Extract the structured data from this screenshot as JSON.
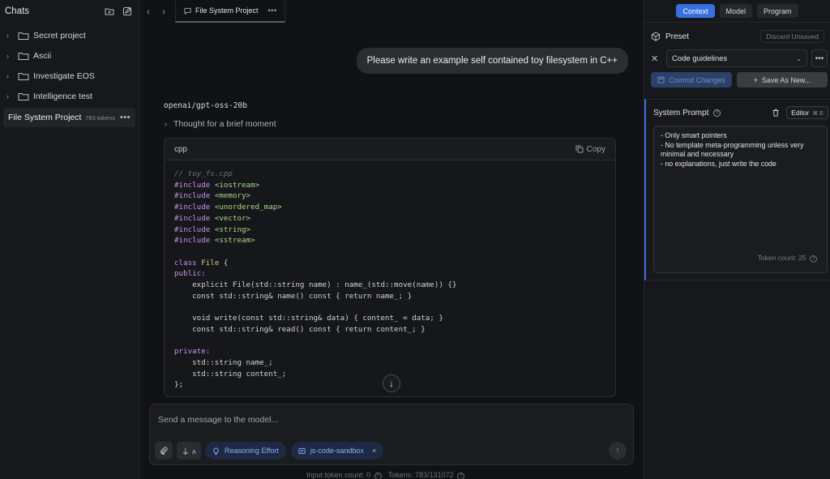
{
  "sidebar": {
    "title": "Chats",
    "items": [
      {
        "label": "Secret project"
      },
      {
        "label": "Ascii"
      },
      {
        "label": "Investigate EOS"
      },
      {
        "label": "Intelligence test"
      }
    ],
    "active": {
      "label": "File System Project",
      "tokens": "783 tokens"
    }
  },
  "topbar": {
    "tab_label": "File System Project"
  },
  "chat": {
    "user_message": "Please write an example self contained toy filesystem in C++",
    "model_name": "openai/gpt-oss-20b",
    "thought": "Thought for a brief moment",
    "code_lang": "cpp",
    "copy_label": "Copy",
    "code": {
      "comment": "// toy_fs.cpp",
      "includes": [
        "<iostream>",
        "<memory>",
        "<unordered_map>",
        "<vector>",
        "<string>",
        "<sstream>"
      ],
      "include_kw": "#include",
      "class_kw": "class",
      "class_name": "File",
      "public_kw": "public:",
      "private_kw": "private:",
      "line_ctor": "explicit File(std::string name) : name_(std::move(name)) {}",
      "line_name": "const std::string& name() const { return name_; }",
      "line_write": "void write(const std::string& data) { content_ = data; }",
      "line_read": "const std::string& read() const { return content_; }",
      "line_m1": "std::string name_;",
      "line_m2": "std::string content_;",
      "line_end": "};"
    }
  },
  "composer": {
    "placeholder": "Send a message to the model...",
    "reasoning_label": "Reasoning Effort",
    "sandbox_label": "js-code-sandbox",
    "input_token_label": "Input token count:",
    "input_token_value": "0",
    "tokens_label": "Tokens:",
    "tokens_value": "783/131072"
  },
  "right_panel": {
    "tabs": [
      "Context",
      "Model",
      "Program"
    ],
    "preset_label": "Preset",
    "discard_label": "Discard Unsaved",
    "preset_value": "Code guidelines",
    "commit_label": "Commit Changes",
    "save_label": "Save As New...",
    "system_prompt_label": "System Prompt",
    "editor_label": "Editor",
    "editor_shortcut": "⌘ E",
    "system_prompt_text": "- Only smart pointers\n- No template meta-programming unless very minimal and necessary\n- no explanations, just write the code",
    "token_count": "Token count: 25"
  },
  "colors": {
    "accent": "#3a6fe0",
    "background": "#111215",
    "panel": "#17181c"
  }
}
